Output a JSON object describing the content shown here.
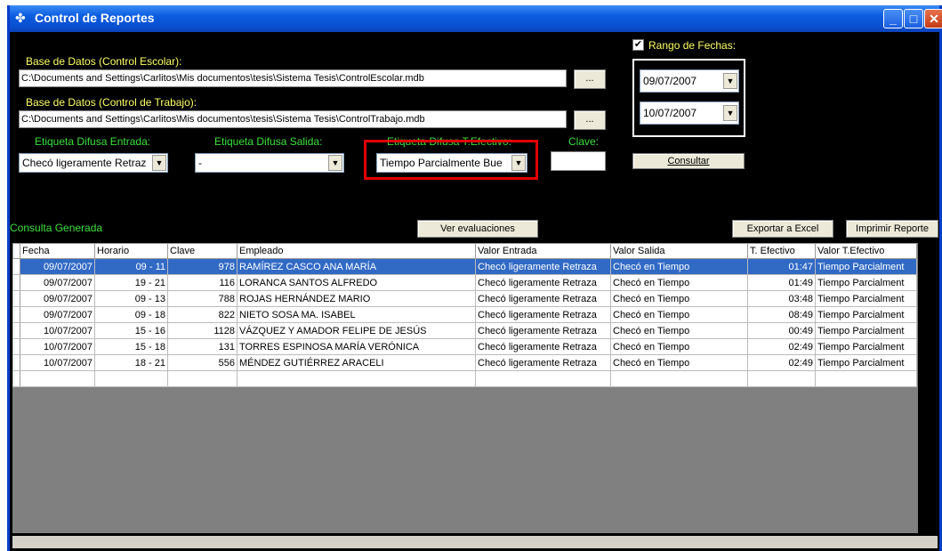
{
  "window": {
    "title": "Control de Reportes",
    "icon": "app-icon"
  },
  "db_escolar": {
    "label": "Base de Datos (Control Escolar):",
    "path": "C:\\Documents and Settings\\Carlitos\\Mis documentos\\tesis\\Sistema Tesis\\ControlEscolar.mdb",
    "browse": "..."
  },
  "db_trabajo": {
    "label": "Base de Datos (Control de Trabajo):",
    "path": "C:\\Documents and Settings\\Carlitos\\Mis documentos\\tesis\\Sistema Tesis\\ControlTrabajo.mdb",
    "browse": "..."
  },
  "filters": {
    "entrada": {
      "label": "Etiqueta Difusa Entrada:",
      "value": "Checó ligeramente Retraz"
    },
    "salida": {
      "label": "Etiqueta Difusa Salida:",
      "value": "-"
    },
    "efectivo": {
      "label": "Etiqueta Difusa T.Efectivo:",
      "value": "Tiempo Parcialmente Bue"
    },
    "clave": {
      "label": "Clave:",
      "value": ""
    }
  },
  "date_range": {
    "label": "Rango de Fechas:",
    "checked": true,
    "from": "09/07/2007",
    "to": "10/07/2007"
  },
  "buttons": {
    "consultar": "Consultar",
    "ver": "Ver evaluaciones",
    "exportar": "Exportar a Excel",
    "imprimir": "Imprimir Reporte"
  },
  "status_label": "Consulta Generada",
  "table": {
    "headers": [
      "Fecha",
      "Horario",
      "Clave",
      "Empleado",
      "Valor Entrada",
      "Valor Salida",
      "T. Efectivo",
      "Valor T.Efectivo"
    ],
    "rows": [
      [
        "09/07/2007",
        "09 - 11",
        "978",
        "RAMÍREZ CASCO ANA MARÍA",
        "Checó ligeramente Retraza",
        "Checó en Tiempo",
        "01:47",
        "Tiempo Parcialment"
      ],
      [
        "09/07/2007",
        "19 - 21",
        "116",
        "LORANCA SANTOS ALFREDO",
        "Checó ligeramente Retraza",
        "Checó en Tiempo",
        "01:49",
        "Tiempo Parcialment"
      ],
      [
        "09/07/2007",
        "09 - 13",
        "788",
        "ROJAS HERNÁNDEZ MARIO",
        "Checó ligeramente Retraza",
        "Checó en Tiempo",
        "03:48",
        "Tiempo Parcialment"
      ],
      [
        "09/07/2007",
        "09 - 18",
        "822",
        "NIETO SOSA MA. ISABEL",
        "Checó ligeramente Retraza",
        "Checó en Tiempo",
        "08:49",
        "Tiempo Parcialment"
      ],
      [
        "10/07/2007",
        "15 - 16",
        "1128",
        "VÁZQUEZ Y AMADOR FELIPE DE JESÚS",
        "Checó ligeramente Retraza",
        "Checó en Tiempo",
        "00:49",
        "Tiempo Parcialment"
      ],
      [
        "10/07/2007",
        "15 - 18",
        "131",
        "TORRES ESPINOSA MARÍA VERÓNICA",
        "Checó ligeramente Retraza",
        "Checó en Tiempo",
        "02:49",
        "Tiempo Parcialment"
      ],
      [
        "10/07/2007",
        "18 - 21",
        "556",
        "MÉNDEZ GUTIÉRREZ ARACELI",
        "Checó ligeramente Retraza",
        "Checó en Tiempo",
        "02:49",
        "Tiempo Parcialment"
      ]
    ]
  }
}
